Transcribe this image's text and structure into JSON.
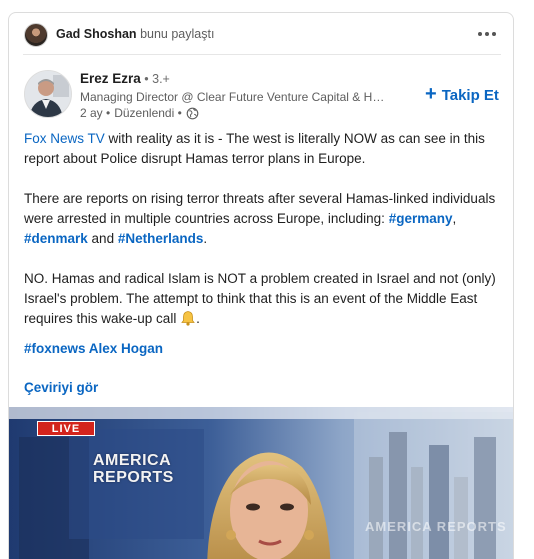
{
  "share": {
    "name": "Gad Shoshan",
    "action": "bunu paylaştı"
  },
  "author": {
    "name": "Erez Ezra",
    "degree": " • 3.+",
    "headline": "Managing Director @ Clear Future Venture Capital & He...",
    "time": "2 ay •",
    "edited": "Düzenlendi •",
    "visibility_icon": "globe-icon"
  },
  "follow": {
    "plus": "+",
    "label": "Takip Et"
  },
  "post": {
    "p1_link": "Fox News TV",
    "p1_text": " with reality as it is - The west is literally NOW as can see in this report about Police disrupt Hamas terror plans in Europe.",
    "p2_text": "There are reports on rising terror threats after several Hamas-linked individuals were arrested in multiple countries across Europe, including: ",
    "p2_tag1": "#germany",
    "p2_sep1": ", ",
    "p2_tag2": "#denmark",
    "p2_sep2": " and ",
    "p2_tag3": "#Netherlands",
    "p2_end": ".",
    "p3_text": "NO. Hamas and radical Islam is NOT a problem created in Israel and not (only) Israel's problem. The attempt to think that this is an event of the Middle East requires this wake-up call ",
    "p3_end": ".",
    "p3_icon": "bell-icon",
    "p4_tag": "#foxnews",
    "p4_mention": " Alex Hogan"
  },
  "translate": {
    "label": "Çeviriyi gör"
  },
  "video": {
    "badge": "LIVE",
    "title": "AMERICA REPORTS",
    "watermark": "AMERICA REPORTS"
  }
}
